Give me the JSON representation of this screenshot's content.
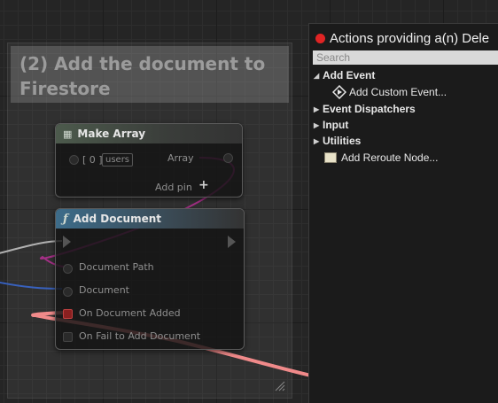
{
  "comment": {
    "title": "(2) Add the document to Firestore"
  },
  "make_array_node": {
    "title": "Make Array",
    "pins": {
      "index_label": "[ 0 ]",
      "index_value": "users",
      "output_label": "Array",
      "add_pin_label": "Add pin",
      "add_pin_icon": "+"
    }
  },
  "add_document_node": {
    "title": "Add Document",
    "function_icon": "ƒ",
    "pins": {
      "document_path": "Document Path",
      "document": "Document",
      "on_added": "On Document Added",
      "on_fail": "On Fail to Add Document"
    }
  },
  "actions_menu": {
    "title": "Actions providing a(n) Dele",
    "search_placeholder": "Search",
    "items": [
      {
        "label": "Add Event",
        "expanded": true
      },
      {
        "label": "Add Custom Event...",
        "icon": "custom-event-icon"
      },
      {
        "label": "Event Dispatchers",
        "expanded": false
      },
      {
        "label": "Input",
        "expanded": false
      },
      {
        "label": "Utilities",
        "expanded": false
      },
      {
        "label": "Add Reroute Node...",
        "icon": "reroute-node-icon"
      }
    ]
  },
  "colors": {
    "delegate_wire": "#f08a8a",
    "array_wire": "#b0308f",
    "exec_wire": "#c8c8c8",
    "object_wire": "#3a6ad6",
    "menu_dot": "#e02424",
    "function_header": "#3d6c8a"
  }
}
